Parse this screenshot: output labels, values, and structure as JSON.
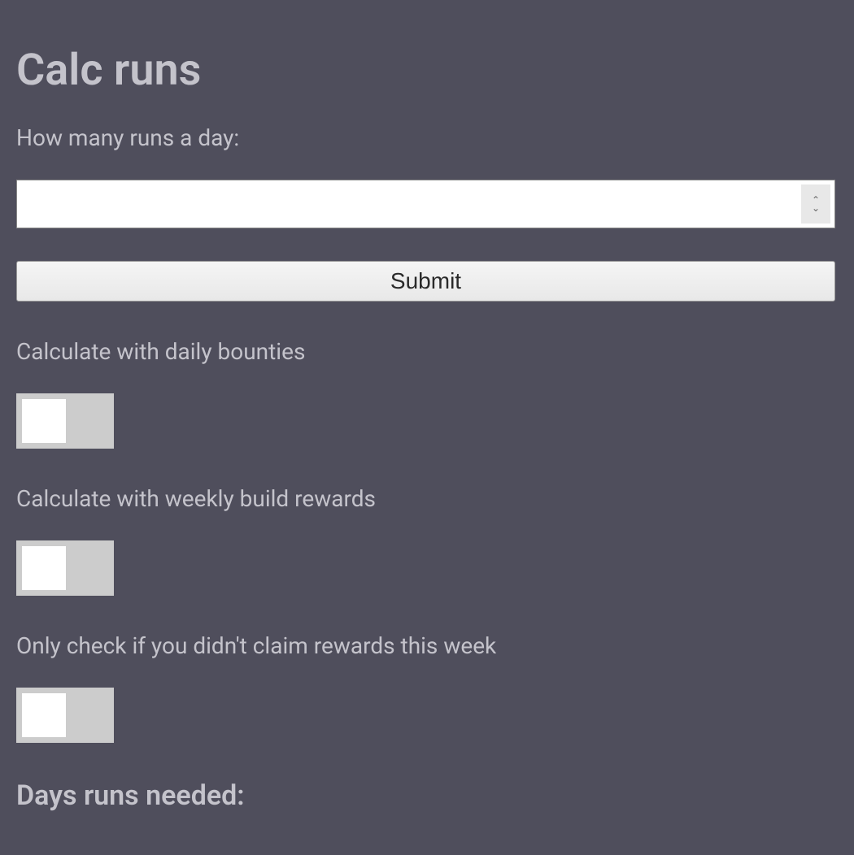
{
  "heading": "Calc runs",
  "form": {
    "runs_label": "How many runs a day:",
    "runs_value": "",
    "submit_label": "Submit",
    "toggles": {
      "daily_bounties": {
        "label": "Calculate with daily bounties",
        "checked": false
      },
      "weekly_build": {
        "label": "Calculate with weekly build rewards",
        "checked": false
      },
      "didnt_claim": {
        "label": "Only check if you didn't claim rewards this week",
        "checked": false
      }
    }
  },
  "result_heading": "Days runs needed:"
}
